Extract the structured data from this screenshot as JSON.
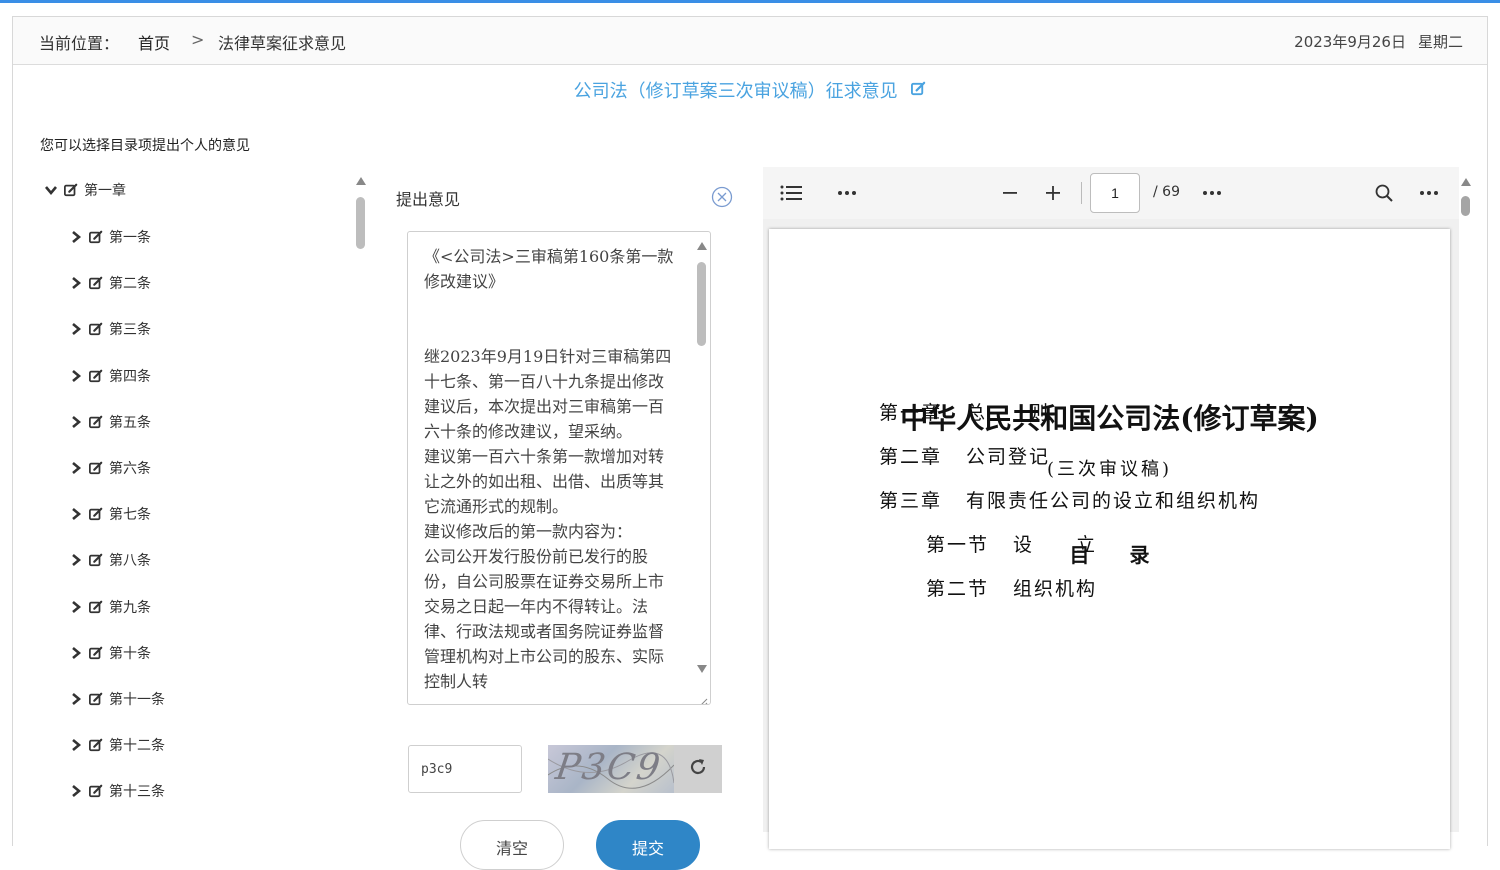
{
  "header": {
    "location_label": "当前位置：",
    "home": "首页",
    "separator": ">",
    "current": "法律草案征求意见",
    "date": "2023年9月26日",
    "weekday": "星期二"
  },
  "page_title": "公司法（修订草案三次审议稿）征求意见",
  "hint": "您可以选择目录项提出个人的意见",
  "tree": {
    "chapter": "第一章",
    "articles": [
      "第一条",
      "第二条",
      "第三条",
      "第四条",
      "第五条",
      "第六条",
      "第七条",
      "第八条",
      "第九条",
      "第十条",
      "第十一条",
      "第十二条",
      "第十三条"
    ]
  },
  "comment": {
    "title": "提出意见",
    "text": "《<公司法>三审稿第160条第一款修改建议》\n\n\n继2023年9月19日针对三审稿第四十七条、第一百八十九条提出修改建议后，本次提出对三审稿第一百六十条的修改建议，望采纳。\n建议第一百六十条第一款增加对转让之外的如出租、出借、出质等其它流通形式的规制。\n建议修改后的第一款内容为：\n公司公开发行股份前已发行的股份，自公司股票在证券交易所上市交易之日起一年内不得转让。法律、行政法规或者国务院证券监督管理机构对上市公司的股东、实际控制人转",
    "captcha_value": "p3c9",
    "captcha_image_text": "P3C9",
    "clear_label": "清空",
    "submit_label": "提交"
  },
  "pdf": {
    "page_current": "1",
    "page_total": "/ 69",
    "doc_title": "中华人民共和国公司法(修订草案)",
    "doc_subtitle": "(三次审议稿)",
    "toc_heading": "目录",
    "toc": [
      {
        "num": "第一章",
        "title": "总　　则"
      },
      {
        "num": "第二章",
        "title": "公司登记"
      },
      {
        "num": "第三章",
        "title": "有限责任公司的设立和组织机构"
      },
      {
        "num": "第一节",
        "title": "设　　立"
      },
      {
        "num": "第二节",
        "title": "组织机构"
      }
    ]
  }
}
